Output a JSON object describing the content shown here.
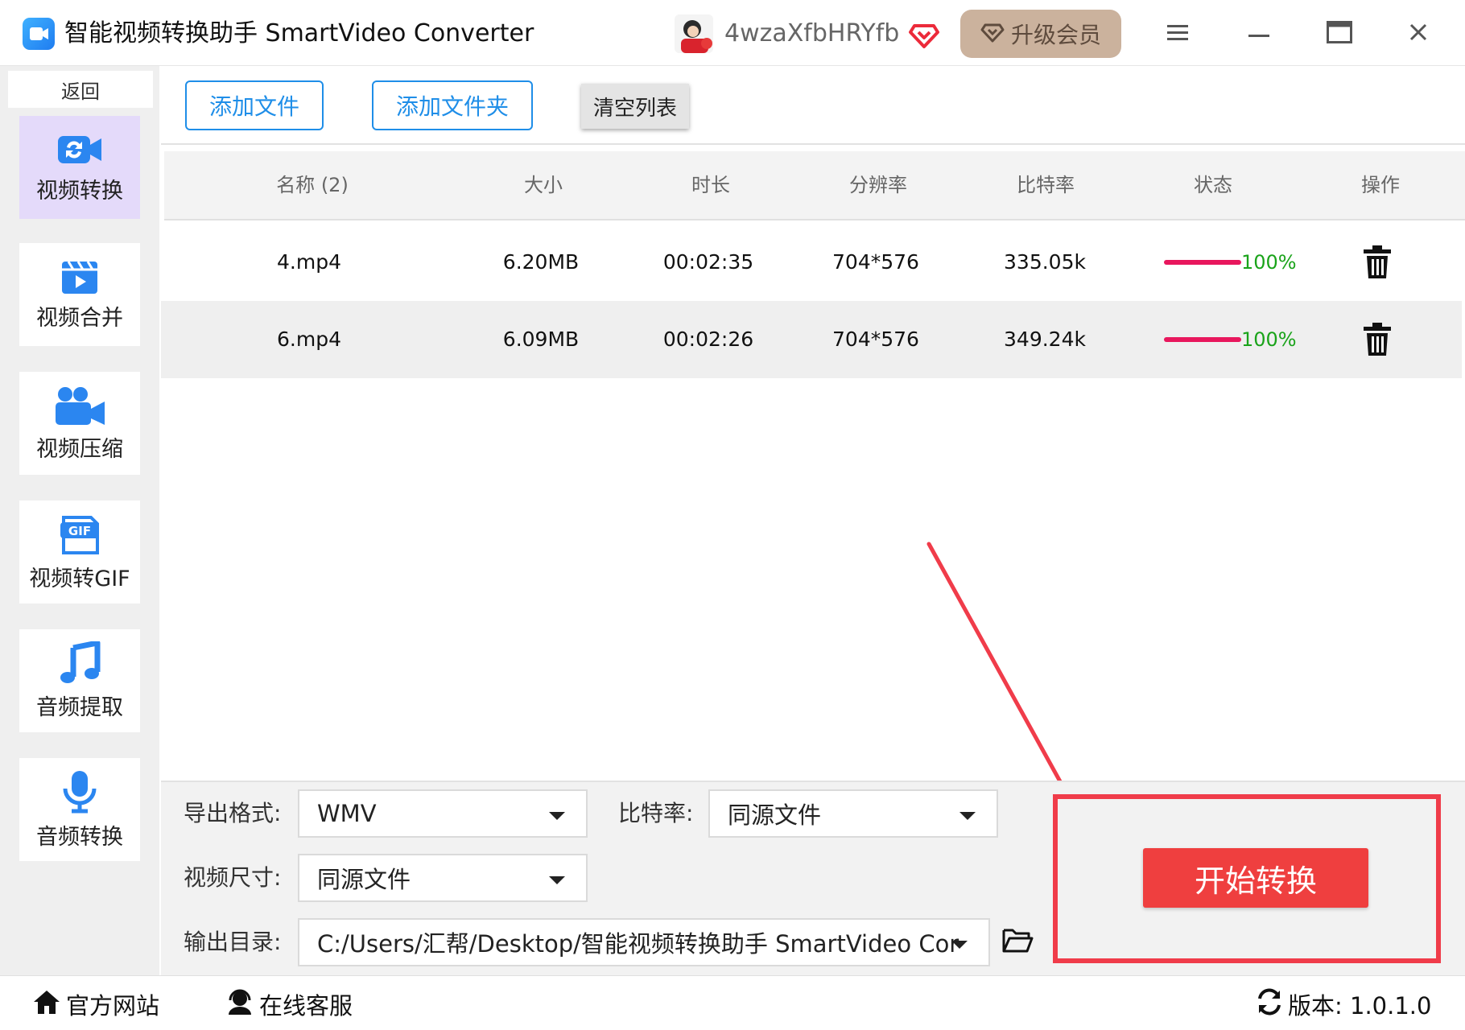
{
  "app": {
    "title": "智能视频转换助手 SmartVideo Converter",
    "username": "4wzaXfbHRYfb",
    "upgrade_label": "升级会员"
  },
  "sidebar": {
    "back_label": "返回",
    "items": [
      {
        "label": "视频转换",
        "icon": "video-convert-icon",
        "active": true
      },
      {
        "label": "视频合并",
        "icon": "video-merge-icon",
        "active": false
      },
      {
        "label": "视频压缩",
        "icon": "video-compress-icon",
        "active": false
      },
      {
        "label": "视频转GIF",
        "icon": "gif-icon",
        "active": false
      },
      {
        "label": "音频提取",
        "icon": "music-note-icon",
        "active": false
      },
      {
        "label": "音频转换",
        "icon": "microphone-icon",
        "active": false
      }
    ]
  },
  "toolbar": {
    "add_file_label": "添加文件",
    "add_folder_label": "添加文件夹",
    "clear_list_label": "清空列表"
  },
  "table": {
    "headers": [
      "名称 (2)",
      "大小",
      "时长",
      "分辨率",
      "比特率",
      "状态",
      "操作"
    ],
    "rows": [
      {
        "name": "4.mp4",
        "size": "6.20MB",
        "duration": "00:02:35",
        "resolution": "704*576",
        "bitrate": "335.05k",
        "progress": 100,
        "progress_text": "100%"
      },
      {
        "name": "6.mp4",
        "size": "6.09MB",
        "duration": "00:02:26",
        "resolution": "704*576",
        "bitrate": "349.24k",
        "progress": 100,
        "progress_text": "100%"
      }
    ]
  },
  "settings": {
    "format_label": "导出格式:",
    "format_value": "WMV",
    "bitrate_label": "比特率:",
    "bitrate_value": "同源文件",
    "size_label": "视频尺寸:",
    "size_value": "同源文件",
    "output_label": "输出目录:",
    "output_value": "C:/Users/汇帮/Desktop/智能视频转换助手 SmartVideo Cor",
    "start_label": "开始转换"
  },
  "footer": {
    "website_label": "官方网站",
    "support_label": "在线客服",
    "version_label": "版本:  1.0.1.0"
  },
  "colors": {
    "accent_blue": "#1f8ee8",
    "start_red": "#ef3f3f",
    "highlight_red": "#f03c4a",
    "progress_pink": "#e8175d",
    "progress_green": "#1aa31a",
    "vip_gold": "#cbb29d",
    "active_nav": "#e4dafa"
  }
}
